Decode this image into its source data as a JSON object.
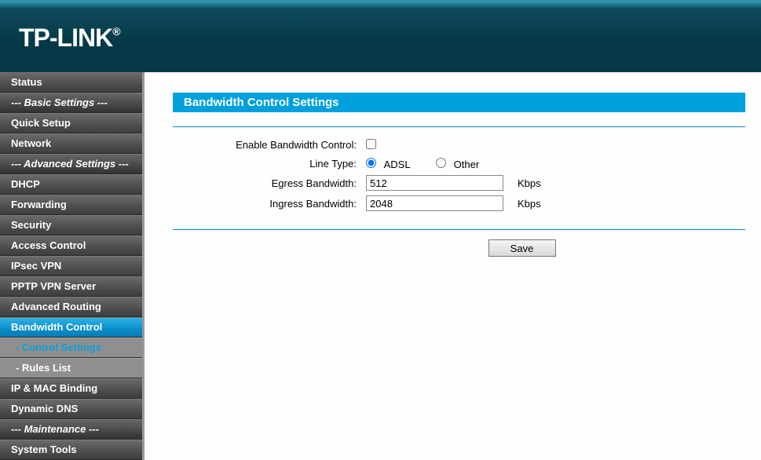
{
  "brand": "TP-LINK",
  "sidebar": {
    "items": [
      {
        "label": "Status",
        "type": "item"
      },
      {
        "label": "--- Basic Settings ---",
        "type": "section"
      },
      {
        "label": "Quick Setup",
        "type": "item"
      },
      {
        "label": "Network",
        "type": "item"
      },
      {
        "label": "--- Advanced Settings ---",
        "type": "section"
      },
      {
        "label": "DHCP",
        "type": "item"
      },
      {
        "label": "Forwarding",
        "type": "item"
      },
      {
        "label": "Security",
        "type": "item"
      },
      {
        "label": "Access Control",
        "type": "item"
      },
      {
        "label": "IPsec VPN",
        "type": "item"
      },
      {
        "label": "PPTP VPN Server",
        "type": "item"
      },
      {
        "label": "Advanced Routing",
        "type": "item"
      },
      {
        "label": "Bandwidth Control",
        "type": "active"
      },
      {
        "label": "- Control Settings",
        "type": "subactive"
      },
      {
        "label": "- Rules List",
        "type": "sub"
      },
      {
        "label": "IP & MAC Binding",
        "type": "item"
      },
      {
        "label": "Dynamic DNS",
        "type": "item"
      },
      {
        "label": "--- Maintenance ---",
        "type": "section"
      },
      {
        "label": "System Tools",
        "type": "item"
      }
    ]
  },
  "page": {
    "title": "Bandwidth Control Settings",
    "enable_label": "Enable Bandwidth Control:",
    "enable_checked": false,
    "line_type_label": "Line Type:",
    "line_type_options": {
      "adsl": "ADSL",
      "other": "Other"
    },
    "line_type_selected": "adsl",
    "egress_label": "Egress Bandwidth:",
    "egress_value": "512",
    "ingress_label": "Ingress Bandwidth:",
    "ingress_value": "2048",
    "unit": "Kbps",
    "save_label": "Save"
  }
}
